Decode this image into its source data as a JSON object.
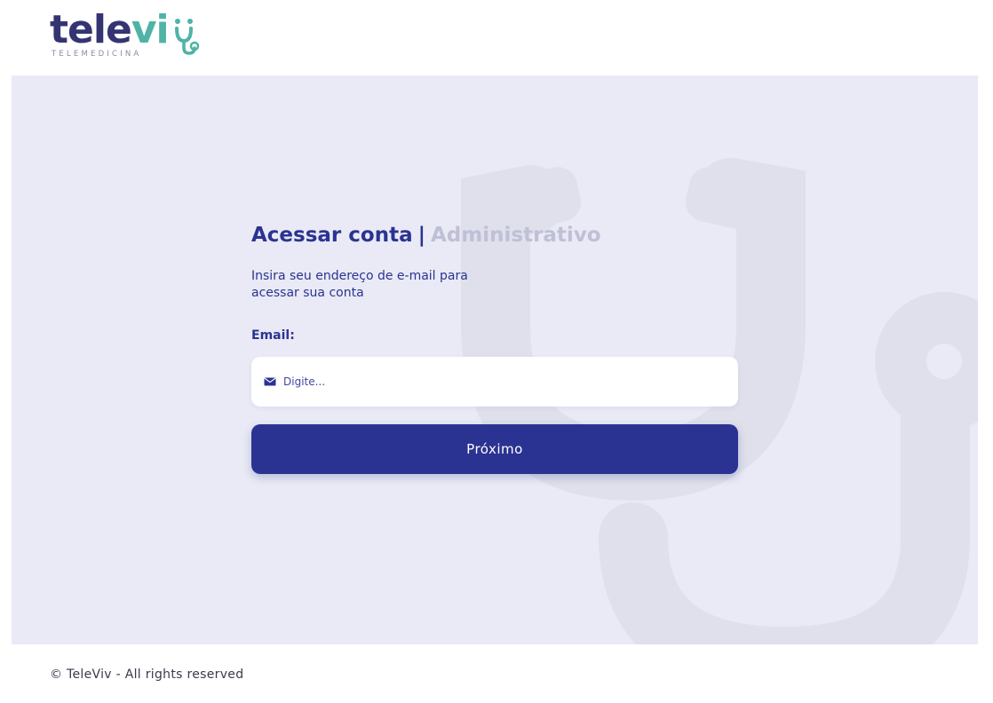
{
  "brand": {
    "logo_part1": "tele",
    "logo_part2": "vi",
    "tagline": "TELEMEDICINA",
    "colors": {
      "dark": "#353472",
      "teal": "#4fb3a6",
      "primary": "#2b3392",
      "background": "#e9eaf5"
    }
  },
  "login": {
    "title": "Acessar conta",
    "separator": "|",
    "title_sub": "Administrativo",
    "subtitle": "Insira seu endereço de e-mail para acessar sua conta",
    "email_label": "Email:",
    "email_placeholder": "Digite...",
    "email_value": "",
    "email_icon": "envelope-icon",
    "submit_label": "Próximo"
  },
  "footer": {
    "text": "© TeleViv - All rights reserved"
  }
}
